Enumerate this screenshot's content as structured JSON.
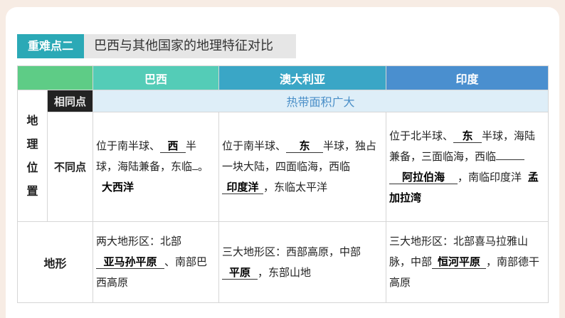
{
  "header": {
    "tag": "重难点二",
    "title": "巴西与其他国家的地理特征对比"
  },
  "columns": [
    "巴西",
    "澳大利亚",
    "印度"
  ],
  "location": {
    "label_chars": [
      "地",
      "理",
      "位",
      "置"
    ],
    "same_label": "相同点",
    "same_text": "热带面积广大",
    "diff_label": "不同点",
    "brazil": {
      "t1": "位于南半球、",
      "a1": "西",
      "t2": "半球，海陆兼备，东临",
      "t3": "。",
      "a2": "大西洋"
    },
    "australia": {
      "t1": "位于南半球、",
      "a1": "东",
      "t2": "半球，独占一块大陆，四面临海，西临",
      "a2": "印度洋",
      "t3": "，东临太平洋"
    },
    "india": {
      "t1": "位于北半球、",
      "a1": "东",
      "t2": "半球，海陆兼备，三面临海，西临",
      "a2": "阿拉伯海",
      "t3": "，南临印度洋",
      "a3": "孟加拉湾"
    }
  },
  "terrain": {
    "label": "地形",
    "brazil": {
      "t1": "两大地形区：北部",
      "a1": "亚马孙平原",
      "t2": "、南部巴西高原"
    },
    "australia": {
      "t1": "三大地形区：西部高原，中部",
      "a1": "平原",
      "t2": "，东部山地"
    },
    "india": {
      "t1": "三大地形区：北部喜马拉雅山脉，中部",
      "a1": "恒河平原",
      "t2": "，南部德干高原"
    }
  }
}
